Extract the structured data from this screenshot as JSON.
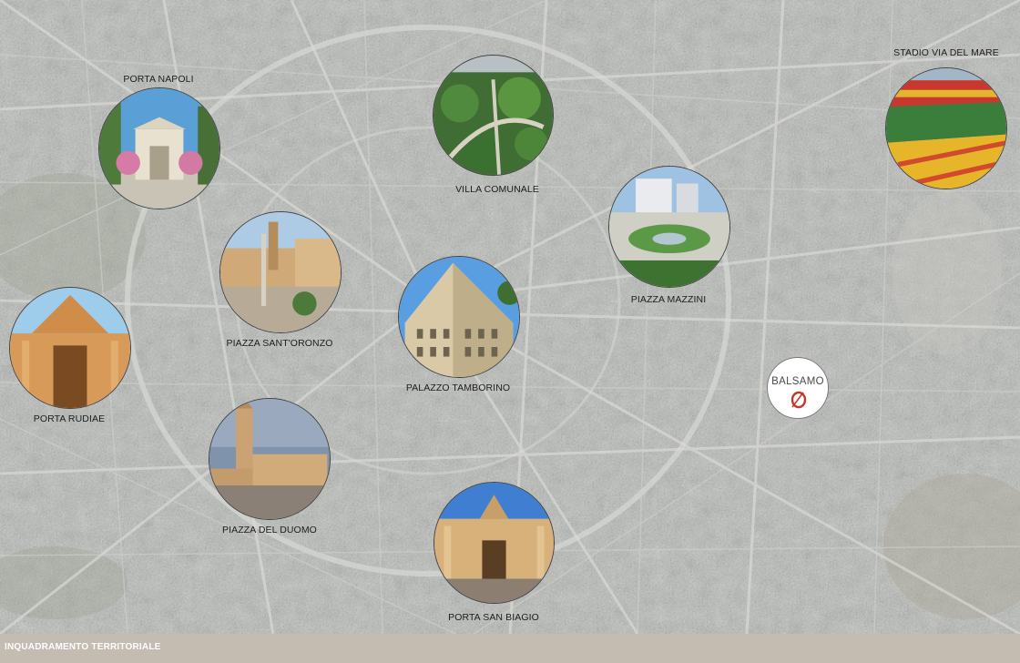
{
  "footer": {
    "title": "INQUADRAMENTO TERRITORIALE"
  },
  "logo": {
    "text": "BALSAMO",
    "brand_color": "#c0392b"
  },
  "landmarks": [
    {
      "label": "PORTA NAPOLI"
    },
    {
      "label": "VILLA COMUNALE"
    },
    {
      "label": "STADIO VIA DEL MARE"
    },
    {
      "label": "PIAZZA MAZZINI"
    },
    {
      "label": "PIAZZA SANT'ORONZO"
    },
    {
      "label": "PALAZZO TAMBORINO"
    },
    {
      "label": "PORTA RUDIAE"
    },
    {
      "label": "PIAZZA DEL DUOMO"
    },
    {
      "label": "PORTA SAN BIAGIO"
    }
  ]
}
